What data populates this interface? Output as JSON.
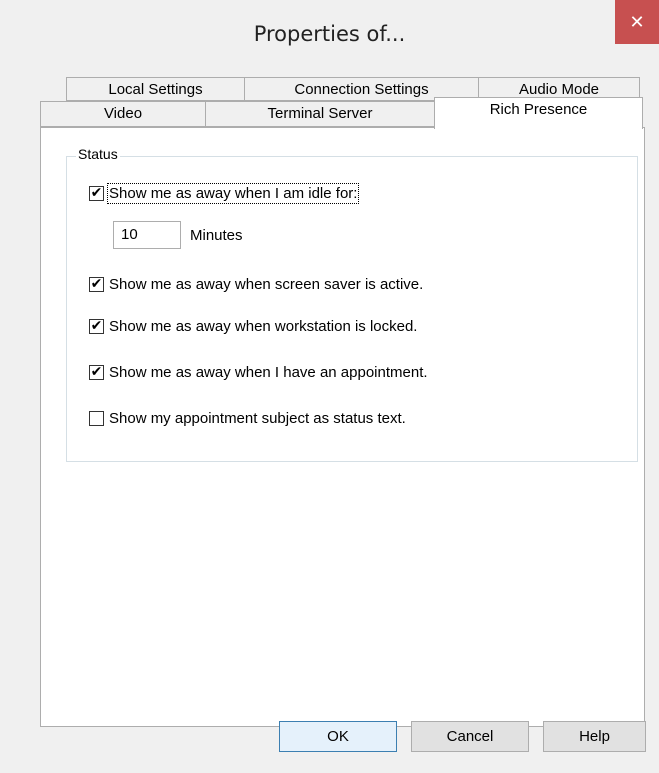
{
  "window": {
    "title": "Properties of...",
    "close_glyph": "✕"
  },
  "tabs_row1": [
    {
      "label": "Local Settings"
    },
    {
      "label": "Connection Settings"
    },
    {
      "label": "Audio Mode"
    }
  ],
  "tabs_row2": [
    {
      "label": "Video"
    },
    {
      "label": "Terminal Server"
    },
    {
      "label": "Rich Presence"
    }
  ],
  "group": {
    "legend": "Status"
  },
  "options": {
    "idle": {
      "label": "Show me as away when I am idle for:",
      "checked": true
    },
    "idle_minutes": {
      "value": "10",
      "unit_label": "Minutes"
    },
    "screensaver": {
      "label": "Show me as away when screen saver is active.",
      "checked": true
    },
    "locked": {
      "label": "Show me as away when workstation is locked.",
      "checked": true
    },
    "appointment": {
      "label": "Show me as away when I have an appointment.",
      "checked": true
    },
    "subject": {
      "label": "Show my appointment subject as status text.",
      "checked": false
    }
  },
  "buttons": {
    "ok": "OK",
    "cancel": "Cancel",
    "help": "Help"
  },
  "check_glyph": "✔"
}
